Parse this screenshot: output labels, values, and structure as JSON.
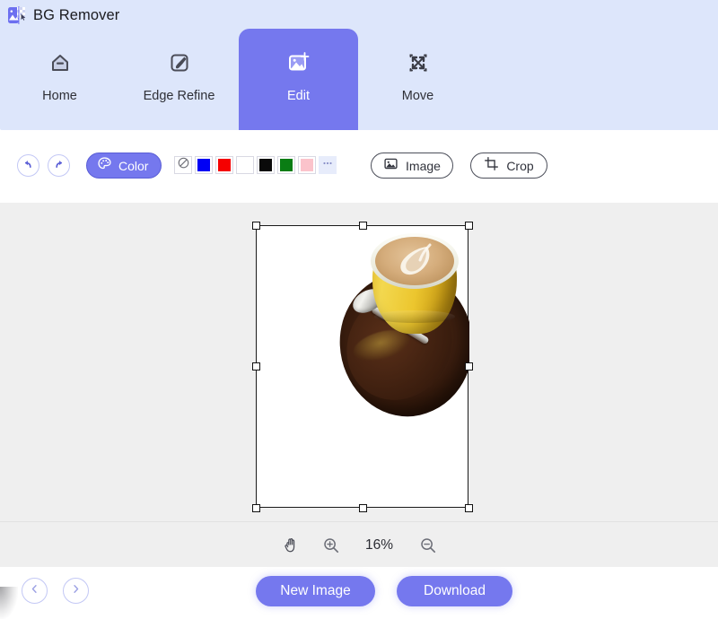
{
  "app": {
    "title": "BG Remover",
    "logo_icon": "image-transparency-icon",
    "accent_color": "#7578ee",
    "header_bg": "#dde6fb",
    "canvas_bg": "#efefef"
  },
  "tabs": [
    {
      "label": "Home",
      "icon": "home-icon",
      "active": false
    },
    {
      "label": "Edge Refine",
      "icon": "edge-refine-icon",
      "active": false
    },
    {
      "label": "Edit",
      "icon": "edit-image-icon",
      "active": true
    },
    {
      "label": "Move",
      "icon": "move-icon",
      "active": false
    }
  ],
  "toolbar": {
    "undo_icon": "undo-arrow-icon",
    "redo_icon": "redo-arrow-icon",
    "color_button": {
      "label": "Color",
      "icon": "palette-icon"
    },
    "swatches": [
      {
        "name": "none",
        "color": "none",
        "icon": "no-color-icon"
      },
      {
        "name": "blue",
        "color": "#0000f5"
      },
      {
        "name": "red",
        "color": "#f50000"
      },
      {
        "name": "white",
        "color": "#ffffff"
      },
      {
        "name": "black",
        "color": "#0a0a0a"
      },
      {
        "name": "green",
        "color": "#0a7d14"
      },
      {
        "name": "pink",
        "color": "#fbc3cb"
      },
      {
        "name": "more",
        "color": "#e7ecfb",
        "icon": "more-dots-icon"
      }
    ],
    "image_button": {
      "label": "Image",
      "icon": "picture-icon"
    },
    "crop_button": {
      "label": "Crop",
      "icon": "crop-icon"
    }
  },
  "canvas": {
    "selected": true,
    "handle_count": 8,
    "artboard_background": "#ffffff",
    "photo_alt": "cappuccino cup with latte art on a dark wooden saucer with a spoon"
  },
  "zoombar": {
    "pan_icon": "hand-icon",
    "zoom_in_icon": "zoom-in-icon",
    "zoom_out_icon": "zoom-out-icon",
    "zoom_level": "16%"
  },
  "bottombar": {
    "prev_icon": "chevron-left-icon",
    "next_icon": "chevron-right-icon",
    "new_image_label": "New Image",
    "download_label": "Download"
  }
}
